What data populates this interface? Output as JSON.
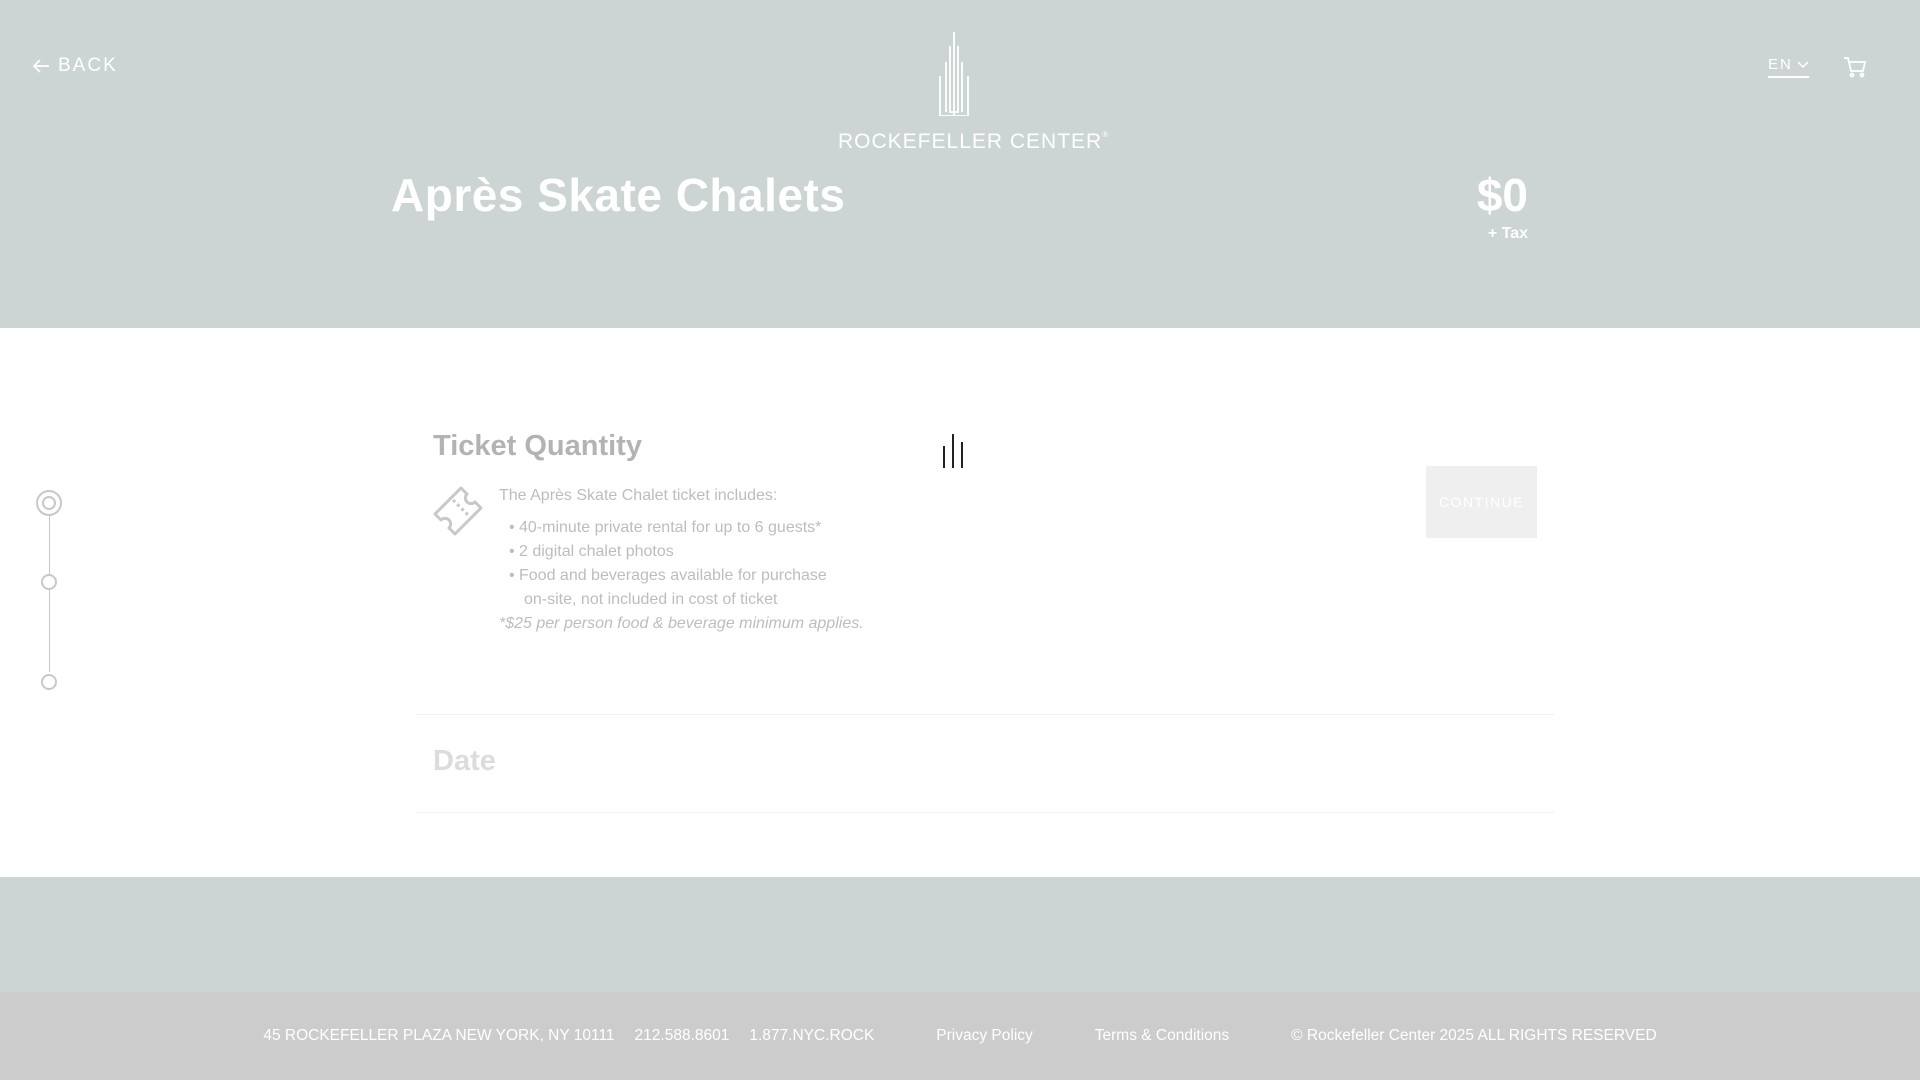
{
  "header": {
    "back_label": "BACK",
    "logo_text": "ROCKEFELLER CENTER",
    "logo_mark": "®",
    "language": "EN"
  },
  "event": {
    "title": "Après Skate Chalets",
    "price": "$0",
    "price_note": "+ Tax"
  },
  "steps": {
    "ticket_quantity": {
      "title": "Ticket Quantity",
      "intro": "The Après Skate Chalet ticket includes:",
      "items": [
        "40-minute private rental for up to 6 guests*",
        "2 digital chalet photos",
        "Food and beverages available for purchase",
        "on-site, not included in cost of ticket"
      ],
      "note": "*$25 per person food & beverage minimum applies.",
      "continue_label": "CONTINUE"
    },
    "date": {
      "title": "Date"
    }
  },
  "footer": {
    "address": "45 ROCKEFELLER PLAZA NEW YORK, NY 10111",
    "phone": "212.588.8601",
    "phone_alt": "1.877.NYC.ROCK",
    "privacy": "Privacy Policy",
    "terms": "Terms & Conditions",
    "copyright": "© Rockefeller Center 2025 ALL RIGHTS RESERVED"
  },
  "colors": {
    "hero_bg": "#ccd5d4",
    "footer_bar_bg": "#cccccc",
    "muted_text": "#b8b8b8",
    "button_bg": "#efefef"
  },
  "icons": [
    "back-arrow-icon",
    "rockefeller-logo-icon",
    "chevron-down-icon",
    "cart-icon",
    "ticket-icon",
    "loading-bars-icon"
  ]
}
